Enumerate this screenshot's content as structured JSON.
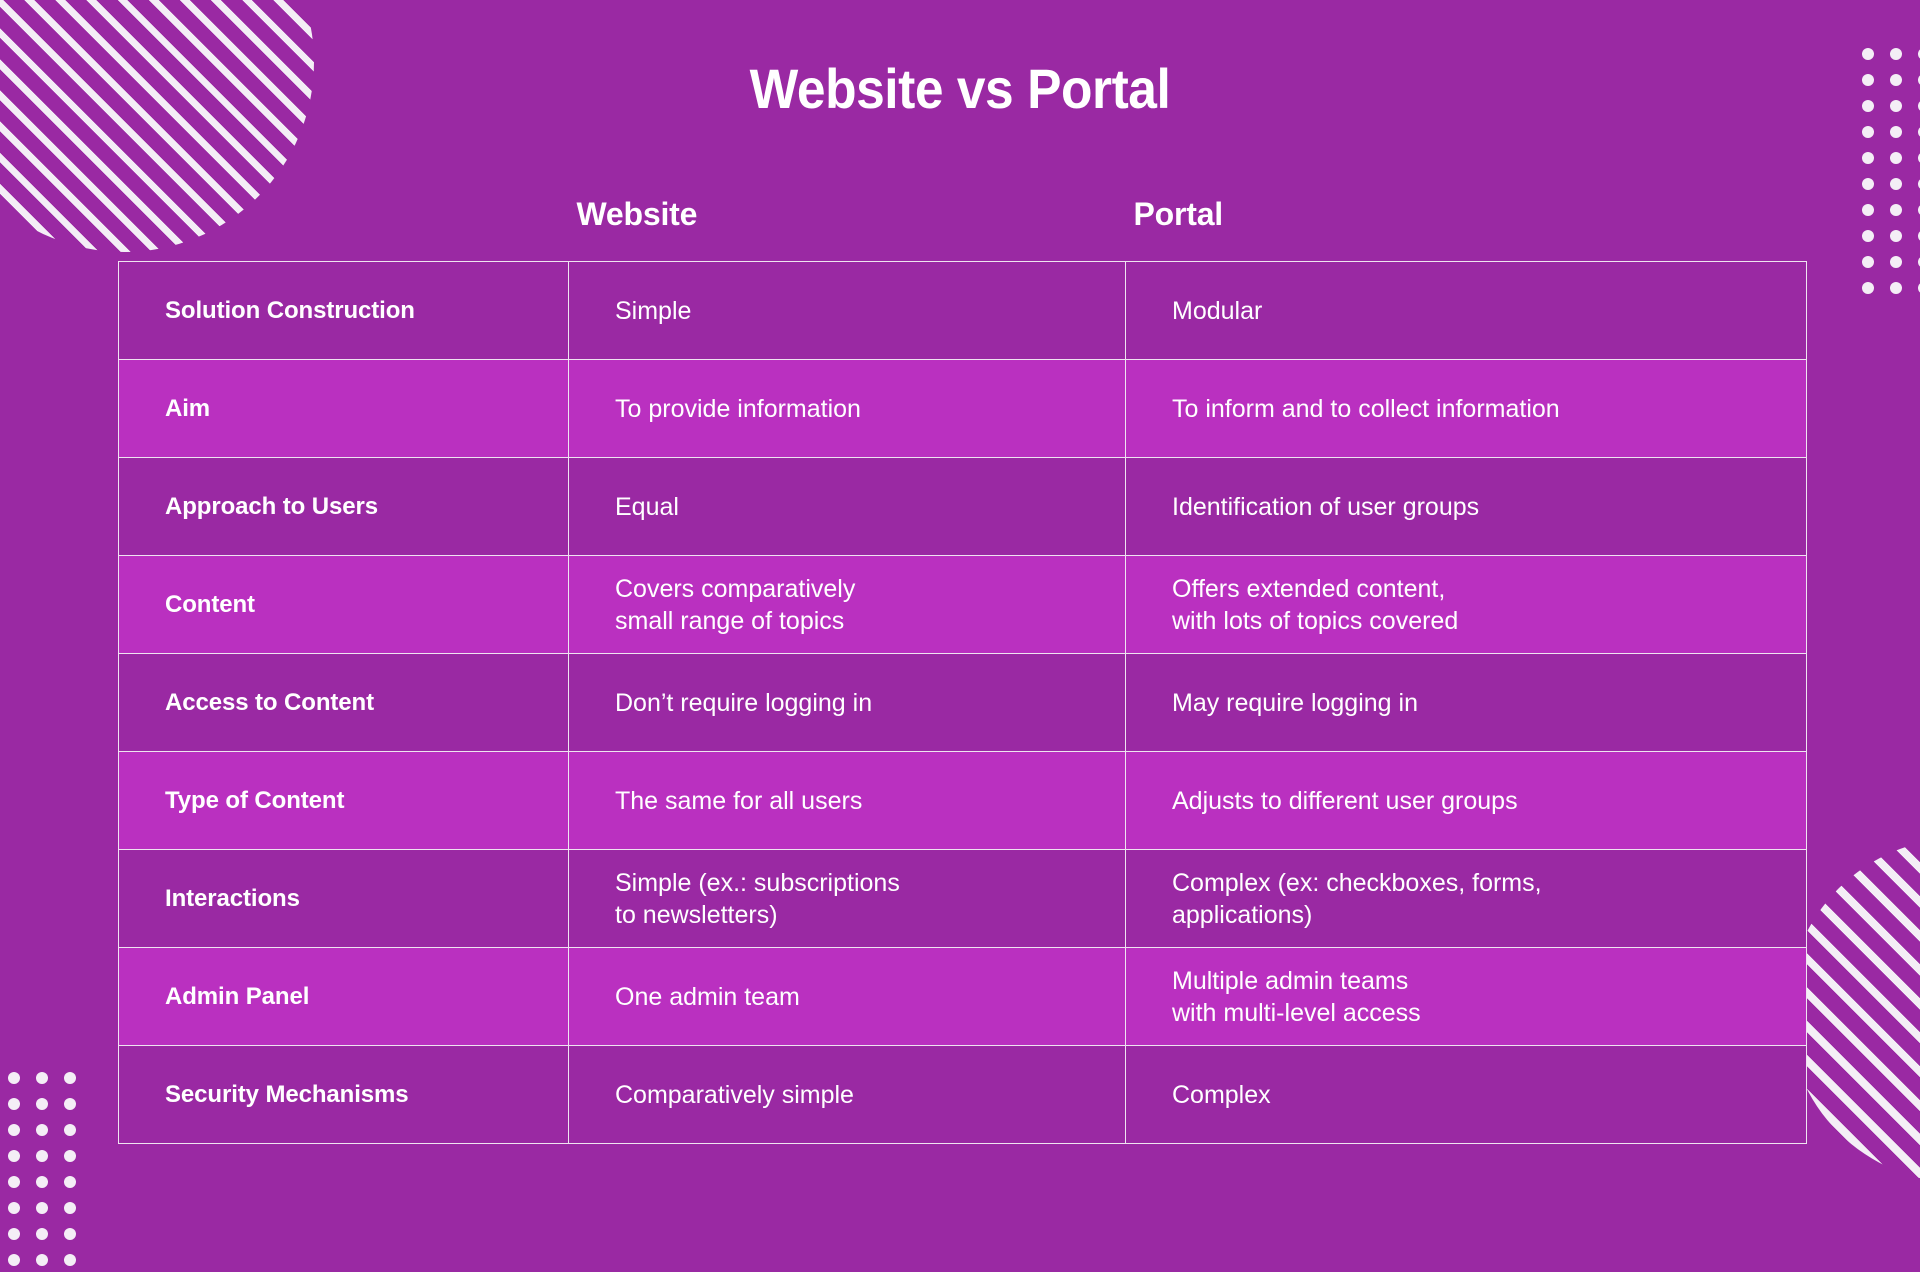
{
  "page": {
    "title": "Website vs Portal",
    "background_color": "#9a29a3",
    "row_dark_color": "#9a29a3",
    "row_light_color": "#ba30c0",
    "text_color": "#ffffff",
    "border_color": "#efe4f1"
  },
  "table": {
    "columns": [
      {
        "key": "label",
        "header": ""
      },
      {
        "key": "website",
        "header": "Website"
      },
      {
        "key": "portal",
        "header": "Portal"
      }
    ],
    "rows": [
      {
        "shade": "dark",
        "label": "Solution Construction",
        "website": {
          "line1": "Simple",
          "line2": ""
        },
        "portal": {
          "line1": "Modular",
          "line2": ""
        }
      },
      {
        "shade": "light",
        "label": "Aim",
        "website": {
          "line1": "To provide information",
          "line2": ""
        },
        "portal": {
          "line1": "To inform and to collect information",
          "line2": ""
        }
      },
      {
        "shade": "dark",
        "label": "Approach to Users",
        "website": {
          "line1": "Equal",
          "line2": ""
        },
        "portal": {
          "line1": "Identification of user groups",
          "line2": ""
        }
      },
      {
        "shade": "light",
        "label": "Content",
        "website": {
          "line1": "Covers comparatively",
          "line2": "small range of topics"
        },
        "portal": {
          "line1": "Offers extended content,",
          "line2": "with lots of topics covered"
        }
      },
      {
        "shade": "dark",
        "label": "Access to Content",
        "website": {
          "line1": "Don’t require logging in",
          "line2": ""
        },
        "portal": {
          "line1": "May require logging in",
          "line2": ""
        }
      },
      {
        "shade": "light",
        "label": "Type of Content",
        "website": {
          "line1": "The same for all users",
          "line2": ""
        },
        "portal": {
          "line1": "Adjusts to different user groups",
          "line2": ""
        }
      },
      {
        "shade": "dark",
        "label": "Interactions",
        "website": {
          "line1": "Simple (ex.: subscriptions",
          "line2": "to newsletters)"
        },
        "portal": {
          "line1": "Complex (ex: checkboxes, forms,",
          "line2": "applications)"
        }
      },
      {
        "shade": "light",
        "label": "Admin Panel",
        "website": {
          "line1": "One admin team",
          "line2": ""
        },
        "portal": {
          "line1": "Multiple admin teams",
          "line2": "with multi-level access"
        }
      },
      {
        "shade": "dark",
        "label": "Security Mechanisms",
        "website": {
          "line1": "Comparatively simple",
          "line2": ""
        },
        "portal": {
          "line1": "Complex",
          "line2": ""
        }
      }
    ]
  },
  "decorations": {
    "stripe_circle_top_left": "striped-circle",
    "stripe_circle_bottom_right": "striped-circle",
    "dot_grid_top_right": {
      "columns": 3,
      "rows": 10
    },
    "dot_grid_bottom_left": {
      "columns": 3,
      "rows": 8
    }
  }
}
